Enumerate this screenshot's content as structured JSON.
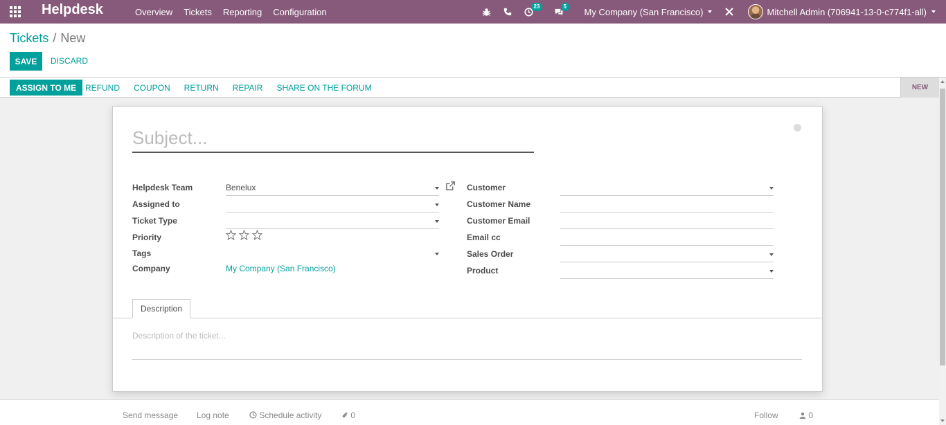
{
  "navbar": {
    "brand": "Helpdesk",
    "menu": [
      "Overview",
      "Tickets",
      "Reporting",
      "Configuration"
    ],
    "activity_count": "23",
    "message_count": "5",
    "company": "My Company (San Francisco)",
    "user": "Mitchell Admin (706941-13-0-c774f1-all)"
  },
  "breadcrumb": {
    "parent": "Tickets",
    "current": "New"
  },
  "buttons": {
    "save": "Save",
    "discard": "Discard"
  },
  "statusbar": {
    "assign": "Assign to me",
    "actions": [
      "Refund",
      "Coupon",
      "Return",
      "Repair",
      "Share on the Forum"
    ],
    "stage": "New"
  },
  "form": {
    "subject_placeholder": "Subject...",
    "left": {
      "helpdesk_team_label": "Helpdesk Team",
      "helpdesk_team_value": "Benelux",
      "assigned_to_label": "Assigned to",
      "ticket_type_label": "Ticket Type",
      "priority_label": "Priority",
      "priority_value": 0,
      "priority_max": 3,
      "tags_label": "Tags",
      "company_label": "Company",
      "company_value": "My Company (San Francisco)"
    },
    "right": {
      "customer_label": "Customer",
      "customer_name_label": "Customer Name",
      "customer_email_label": "Customer Email",
      "email_cc_label": "Email cc",
      "sales_order_label": "Sales Order",
      "product_label": "Product"
    },
    "tab_description": "Description",
    "description_placeholder": "Description of the ticket..."
  },
  "chatter": {
    "send_message": "Send message",
    "log_note": "Log note",
    "schedule_activity": "Schedule activity",
    "attachments": "0",
    "follow": "Follow",
    "followers": "0"
  },
  "colors": {
    "brand": "#875a7b",
    "primary": "#00a09d"
  }
}
